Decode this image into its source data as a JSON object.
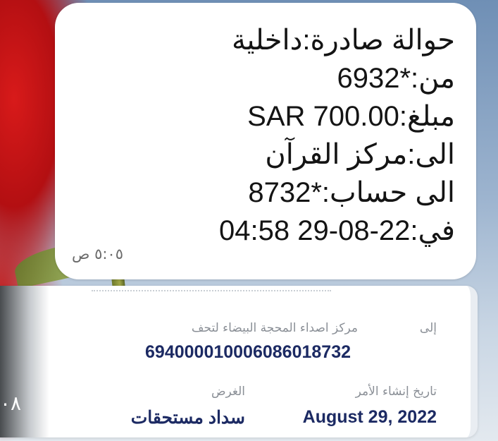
{
  "message": {
    "lines": [
      "حوالة صادرة:داخلية",
      "من:*6932",
      "مبلغ:SAR 700.00",
      "الى:مركز القرآن",
      "الى حساب:*8732",
      "في:22-08-29 04:58"
    ],
    "time": "٥:٠٥ ص"
  },
  "card": {
    "to_label": "إلى",
    "to_name": "مركز اصداء المحجة البيضاء لتحف",
    "to_account": "694000010006086018732",
    "date_label": "تاريخ إنشاء الأمر",
    "date_value": "August 29, 2022",
    "purpose_label": "الغرض",
    "purpose_value": "سداد مستحقات"
  },
  "overlay": {
    "corner_text": "٠٨"
  }
}
